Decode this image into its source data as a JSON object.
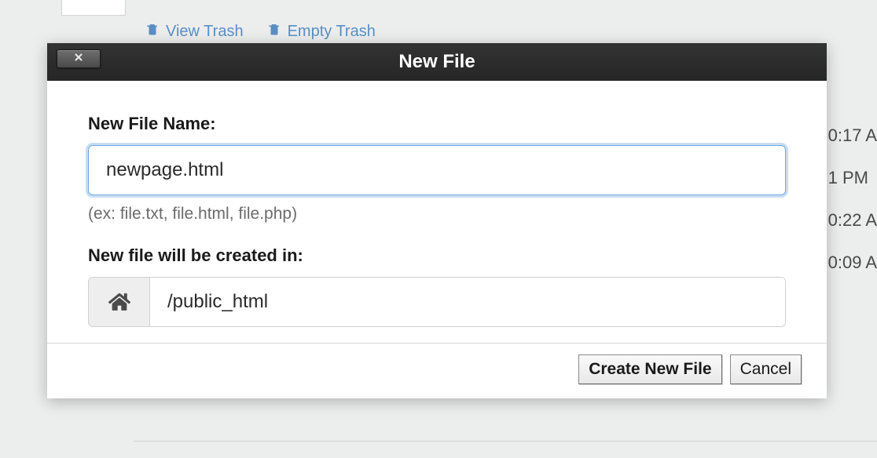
{
  "background": {
    "toolbar": {
      "view_trash": "View Trash",
      "empty_trash": "Empty Trash"
    },
    "times": [
      "0:17 A",
      "1 PM",
      "0:22 A",
      "0:09 A"
    ]
  },
  "modal": {
    "title": "New File",
    "filename_label": "New File Name:",
    "filename_value": "newpage.html",
    "filename_hint": "(ex: file.txt, file.html, file.php)",
    "path_label": "New file will be created in:",
    "path_value": "/public_html",
    "create_button": "Create New File",
    "cancel_button": "Cancel"
  }
}
